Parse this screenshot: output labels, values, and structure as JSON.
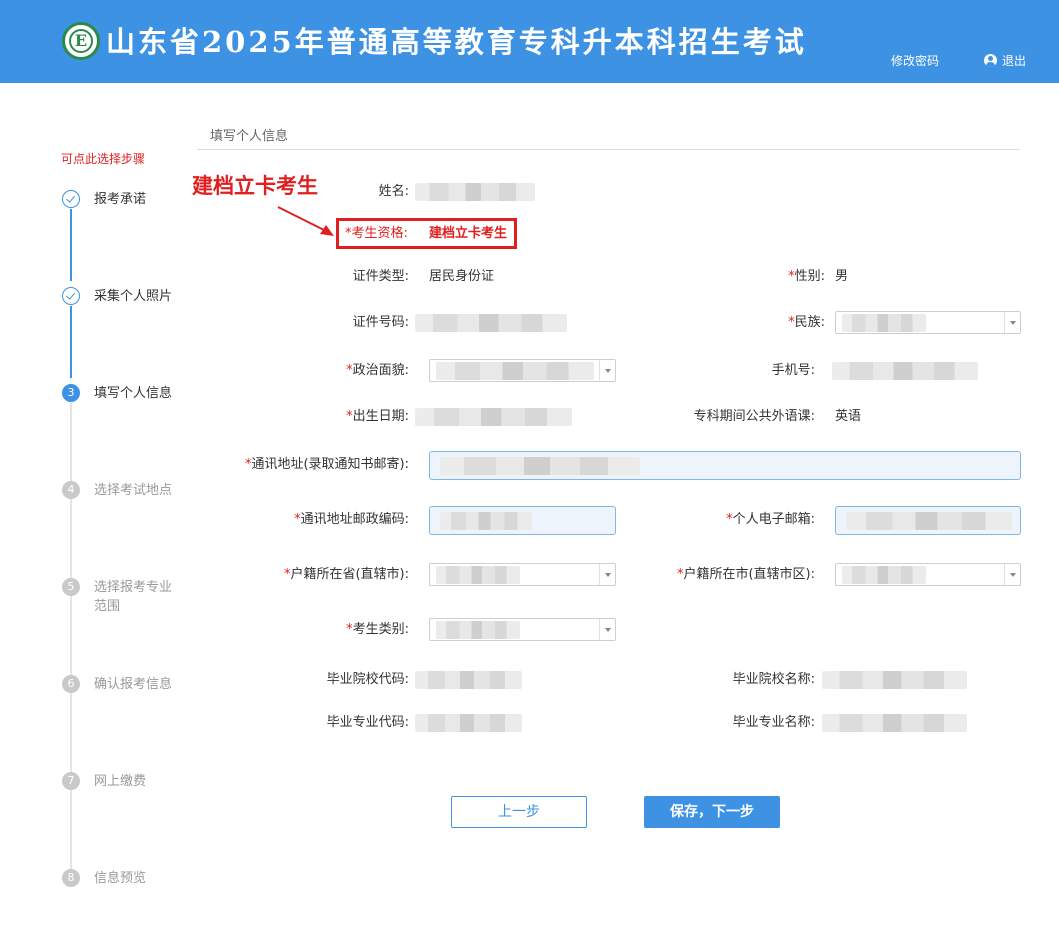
{
  "header": {
    "logo_letter": "E",
    "title": "山东省2025年普通高等教育专科升本科招生考试",
    "change_password": "修改密码",
    "logout": "退出"
  },
  "sidebar": {
    "hint": "可点此选择步骤",
    "steps": [
      {
        "num": "",
        "label": "报考承诺",
        "state": "done"
      },
      {
        "num": "",
        "label": "采集个人照片",
        "state": "done"
      },
      {
        "num": "3",
        "label": "填写个人信息",
        "state": "active"
      },
      {
        "num": "4",
        "label": "选择考试地点",
        "state": "todo"
      },
      {
        "num": "5",
        "label": "选择报考专业范围",
        "state": "todo"
      },
      {
        "num": "6",
        "label": "确认报考信息",
        "state": "todo"
      },
      {
        "num": "7",
        "label": "网上缴费",
        "state": "todo"
      },
      {
        "num": "8",
        "label": "信息预览",
        "state": "todo"
      }
    ]
  },
  "form": {
    "section_title": "填写个人信息",
    "required_mark": "*",
    "name_label": "姓名:",
    "qualification_label": "考生资格:",
    "qualification_value": "建档立卡考生",
    "id_type_label": "证件类型:",
    "id_type_value": "居民身份证",
    "gender_label": "性别:",
    "gender_value": "男",
    "id_number_label": "证件号码:",
    "ethnicity_label": "民族:",
    "political_label": "政治面貌:",
    "phone_label": "手机号:",
    "birth_label": "出生日期:",
    "foreign_lang_label": "专科期间公共外语课:",
    "foreign_lang_value": "英语",
    "address_label": "通讯地址(录取通知书邮寄):",
    "postcode_label": "通讯地址邮政编码:",
    "email_label": "个人电子邮箱:",
    "hukou_province_label": "户籍所在省(直辖市):",
    "hukou_city_label": "户籍所在市(直辖市区):",
    "category_label": "考生类别:",
    "school_code_label": "毕业院校代码:",
    "school_name_label": "毕业院校名称:",
    "major_code_label": "毕业专业代码:",
    "major_name_label": "毕业专业名称:"
  },
  "annotation": {
    "text": "建档立卡考生"
  },
  "buttons": {
    "prev": "上一步",
    "next": "保存，下一步"
  },
  "colors": {
    "header_bg": "#3d92e4",
    "accent": "#3d92e4",
    "required": "#e02020",
    "annotation": "#e02020"
  }
}
